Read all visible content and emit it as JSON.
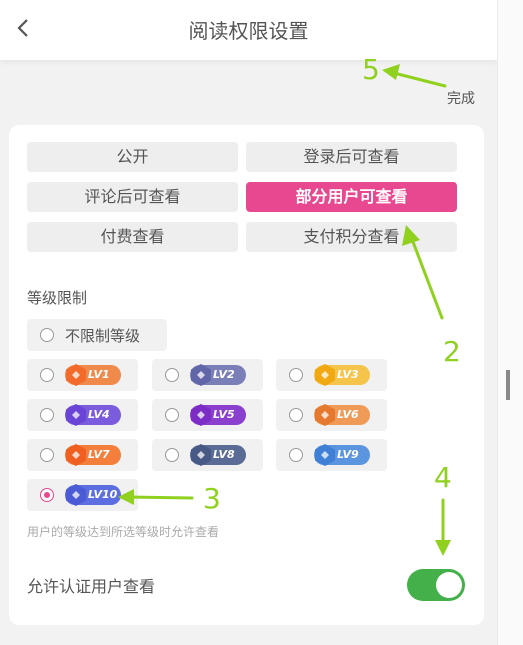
{
  "header": {
    "title": "阅读权限设置"
  },
  "done_label": "完成",
  "permission_options": [
    {
      "label": "公开",
      "active": false
    },
    {
      "label": "登录后可查看",
      "active": false
    },
    {
      "label": "评论后可查看",
      "active": false
    },
    {
      "label": "部分用户可查看",
      "active": true
    },
    {
      "label": "付费查看",
      "active": false
    },
    {
      "label": "支付积分查看",
      "active": false
    }
  ],
  "level_section": {
    "label": "等级限制",
    "unlimited_label": "不限制等级",
    "levels": [
      {
        "label": "LV1",
        "color": "#f08a4b",
        "gem": "#f26b2a",
        "checked": false
      },
      {
        "label": "LV2",
        "color": "#7b7fb8",
        "gem": "#6166a8",
        "checked": false
      },
      {
        "label": "LV3",
        "color": "#f5c44a",
        "gem": "#f0a912",
        "checked": false
      },
      {
        "label": "LV4",
        "color": "#7a5cdc",
        "gem": "#6a44d6",
        "checked": false
      },
      {
        "label": "LV5",
        "color": "#8b3fcf",
        "gem": "#7a2cc4",
        "checked": false
      },
      {
        "label": "LV6",
        "color": "#f09a58",
        "gem": "#e5792f",
        "checked": false
      },
      {
        "label": "LV7",
        "color": "#f47e3b",
        "gem": "#ef5f20",
        "checked": false
      },
      {
        "label": "LV8",
        "color": "#5a6c96",
        "gem": "#475a86",
        "checked": false
      },
      {
        "label": "LV9",
        "color": "#5b95e0",
        "gem": "#3f7fd6",
        "checked": false
      },
      {
        "label": "LV10",
        "color": "#5d6fe0",
        "gem": "#4b5bd6",
        "checked": true
      }
    ],
    "hint": "用户的等级达到所选等级时允许查看"
  },
  "certified_users": {
    "label": "允许认证用户查看",
    "enabled": true
  },
  "annotations": [
    "5",
    "2",
    "3",
    "4"
  ],
  "colors": {
    "accent_pink": "#e8488f",
    "toggle_green": "#43b049",
    "annotation_green": "#8fd11e"
  }
}
